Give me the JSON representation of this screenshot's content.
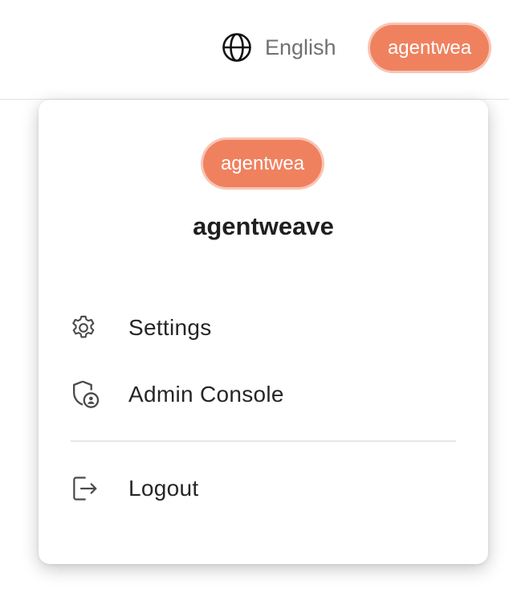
{
  "header": {
    "language": {
      "icon": "globe-icon",
      "label": "English"
    },
    "user_avatar": {
      "label": "agentwea",
      "color": "#f0815f"
    }
  },
  "user_menu": {
    "avatar_label": "agentwea",
    "username": "agentweave",
    "items": [
      {
        "icon": "gear-icon",
        "label": "Settings"
      },
      {
        "icon": "admin-shield-icon",
        "label": "Admin Console"
      },
      {
        "icon": "logout-icon",
        "label": "Logout"
      }
    ]
  }
}
